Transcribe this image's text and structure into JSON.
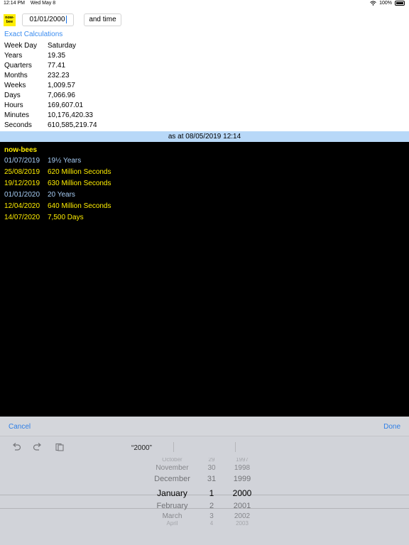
{
  "status": {
    "time": "12:14 PM",
    "date": "Wed May 8",
    "battery": "100%"
  },
  "logo": {
    "line1": "now-",
    "line2": "bee"
  },
  "date_field": {
    "value": "01/01/2000"
  },
  "time_button": {
    "label": "and time"
  },
  "exact_link": "Exact Calculations",
  "calculations": [
    {
      "label": "Week Day",
      "value": "Saturday"
    },
    {
      "label": "Years",
      "value": "19.35"
    },
    {
      "label": "Quarters",
      "value": "77.41"
    },
    {
      "label": "Months",
      "value": "232.23"
    },
    {
      "label": "Weeks",
      "value": "1,009.57"
    },
    {
      "label": "Days",
      "value": "7,066.96"
    },
    {
      "label": "Hours",
      "value": "169,607.01"
    },
    {
      "label": "Minutes",
      "value": "10,176,420.33"
    },
    {
      "label": "Seconds",
      "value": "610,585,219.74"
    }
  ],
  "as_at": "as at 08/05/2019 12:14",
  "now_bees": {
    "title": "now-bees",
    "items": [
      {
        "date": "01/07/2019",
        "text": "19½ Years",
        "color": "#a7cdf5"
      },
      {
        "date": "25/08/2019",
        "text": "620 Million Seconds",
        "color": "#ffee00"
      },
      {
        "date": "19/12/2019",
        "text": "630 Million Seconds",
        "color": "#ffee00"
      },
      {
        "date": "01/01/2020",
        "text": "20 Years",
        "color": "#a7cdf5"
      },
      {
        "date": "12/04/2020",
        "text": "640 Million Seconds",
        "color": "#ffee00"
      },
      {
        "date": "14/07/2020",
        "text": "7,500 Days",
        "color": "#ffee00"
      }
    ]
  },
  "picker": {
    "cancel_label": "Cancel",
    "done_label": "Done",
    "suggestion": "“2000”",
    "icons": [
      "undo-icon",
      "redo-icon",
      "paste-icon"
    ],
    "months": [
      "October",
      "November",
      "December",
      "January",
      "February",
      "March",
      "April"
    ],
    "days": [
      "29",
      "30",
      "31",
      "1",
      "2",
      "3",
      "4"
    ],
    "years": [
      "1997",
      "1998",
      "1999",
      "2000",
      "2001",
      "2002",
      "2003"
    ],
    "selected_index": 3
  }
}
